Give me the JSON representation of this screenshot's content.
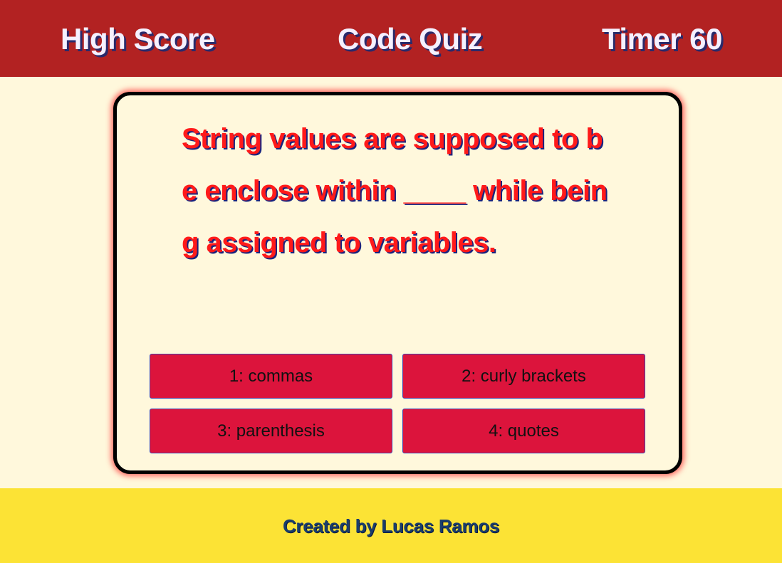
{
  "header": {
    "high_score_label": "High Score",
    "title": "Code Quiz",
    "timer_label": "Timer",
    "timer_value": "60"
  },
  "quiz": {
    "question": "String values are supposed to be enclose within ____ while being assigned to variables.",
    "answers": [
      "1: commas",
      "2: curly brackets",
      "3: parenthesis",
      "4: quotes"
    ]
  },
  "footer": {
    "credit": "Created by Lucas Ramos"
  },
  "colors": {
    "header_bg": "#b22222",
    "page_bg": "#fff8dc",
    "answer_bg": "#dc143c",
    "question_text": "#ff1a1a",
    "footer_bg": "#fce335",
    "footer_text": "#1a3d6b"
  }
}
